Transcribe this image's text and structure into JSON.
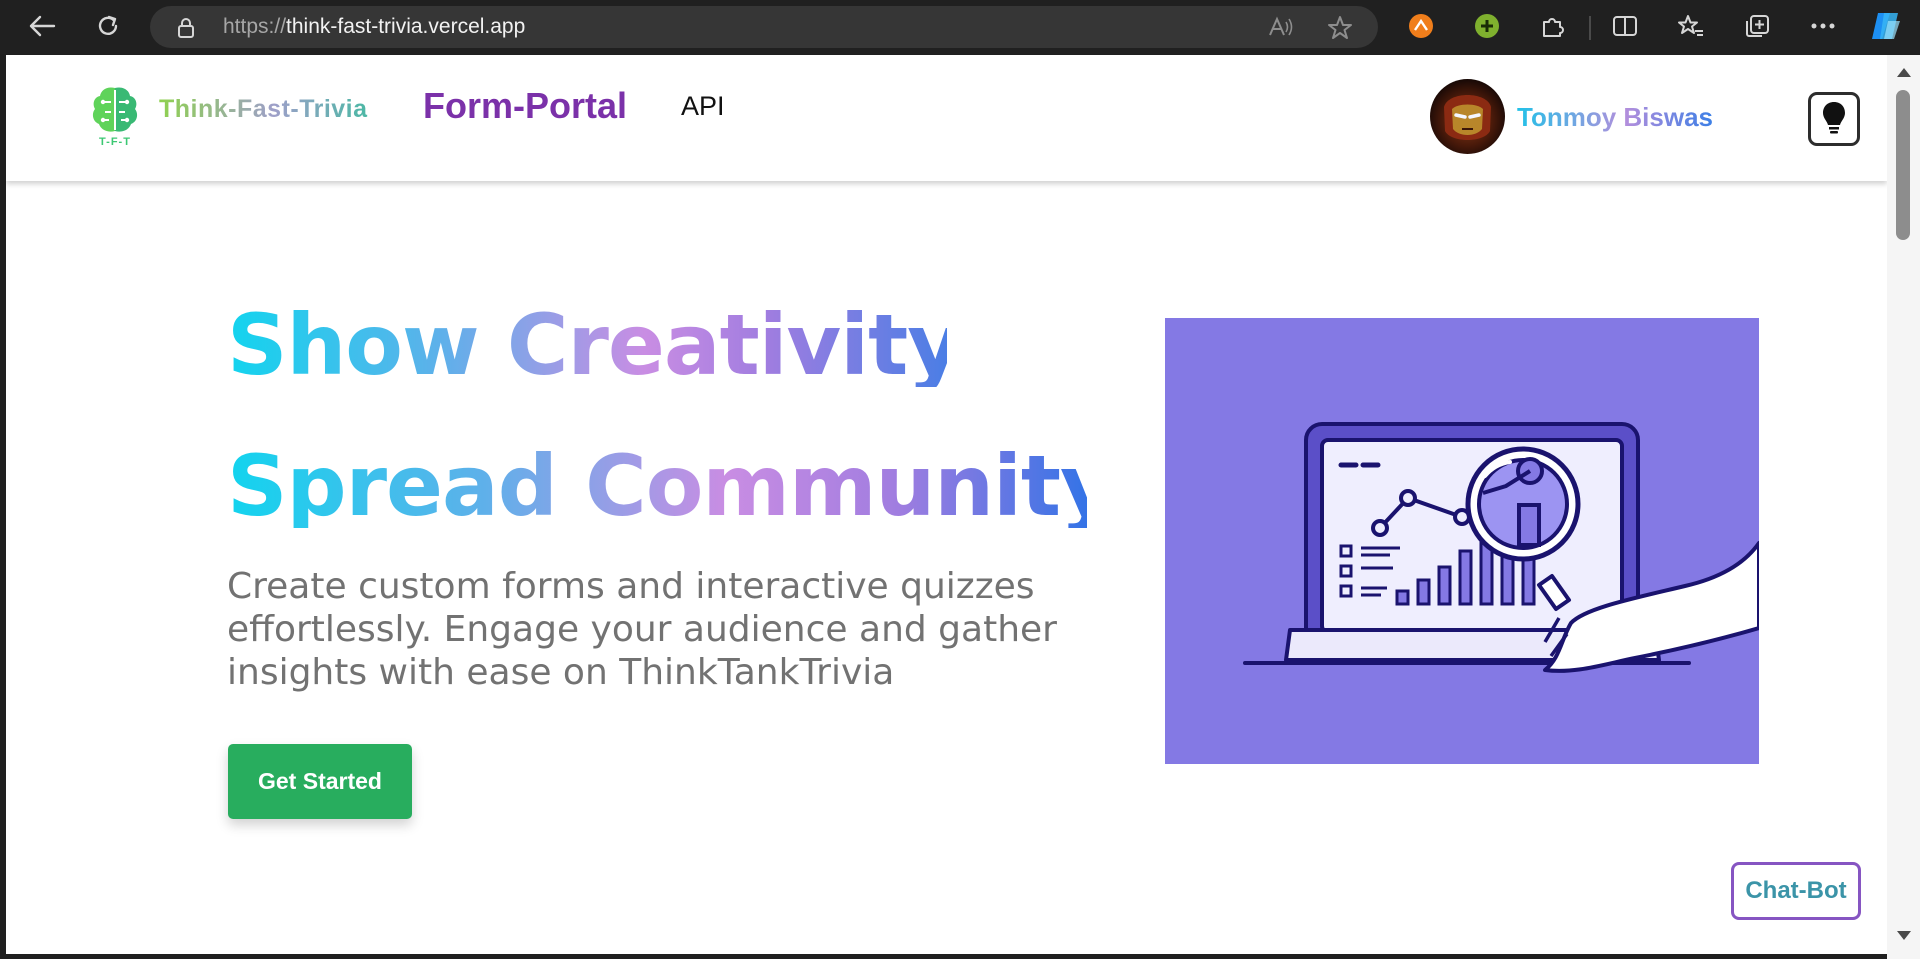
{
  "browser": {
    "url_protocol": "https://",
    "url_host": "think-fast-trivia.vercel.app"
  },
  "navbar": {
    "logo_text": "T-F-T",
    "brand": "Think-Fast-Trivia",
    "links": [
      "Form-Portal",
      "API"
    ],
    "user_name": "Tonmoy Biswas"
  },
  "hero": {
    "headline_1": "Show Creativity.",
    "headline_2": "Spread Community",
    "subtitle": "Create custom forms and interactive quizzes effortlessly. Engage your audience and gather insights with ease on ThinkTankTrivia",
    "cta_label": "Get Started"
  },
  "chatbot_label": "Chat-Bot",
  "colors": {
    "illustration_bg": "#8479e4",
    "cta_green": "#28ad5e",
    "form_portal_purple": "#7b31a9"
  }
}
